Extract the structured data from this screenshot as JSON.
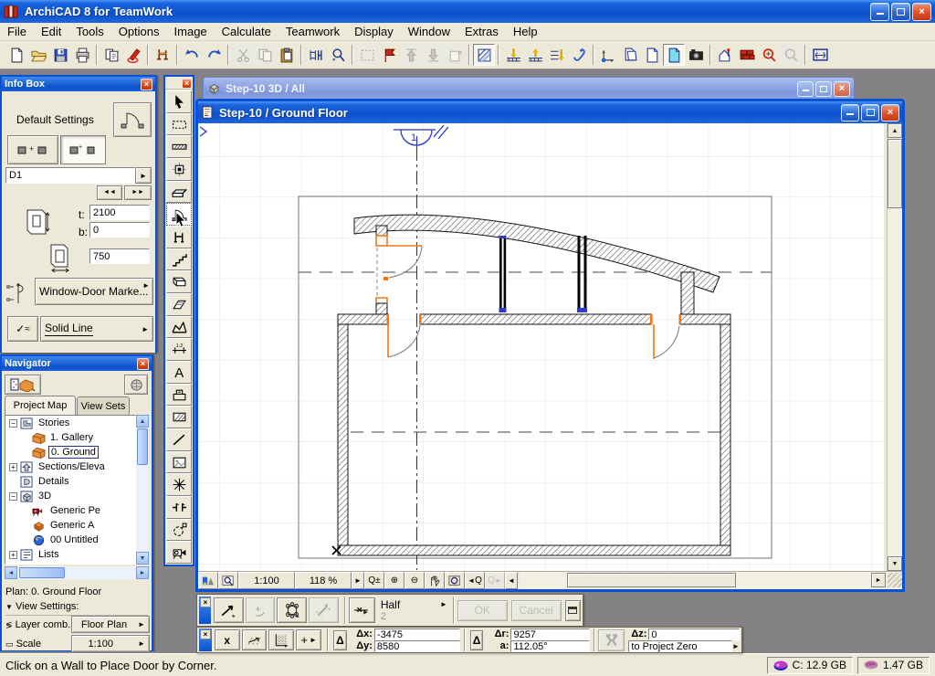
{
  "window": {
    "title": "ArchiCAD 8 for TeamWork"
  },
  "menu": {
    "items": [
      "File",
      "Edit",
      "Tools",
      "Options",
      "Image",
      "Calculate",
      "Teamwork",
      "Display",
      "Window",
      "Extras",
      "Help"
    ]
  },
  "toolbar": {
    "buttons": [
      {
        "name": "new-document"
      },
      {
        "name": "open"
      },
      {
        "name": "save"
      },
      {
        "name": "print"
      },
      {
        "sep": 1
      },
      {
        "name": "publisher"
      },
      {
        "name": "mark-up"
      },
      {
        "sep": 1
      },
      {
        "name": "teamwork"
      },
      {
        "sep": 1
      },
      {
        "name": "undo"
      },
      {
        "name": "redo"
      },
      {
        "sep": 1
      },
      {
        "name": "cut",
        "state": "disabled"
      },
      {
        "name": "copy",
        "state": "disabled"
      },
      {
        "name": "paste"
      },
      {
        "sep": 1
      },
      {
        "name": "dimensions"
      },
      {
        "name": "find-select"
      },
      {
        "sep": 1
      },
      {
        "name": "selections",
        "state": "disabled"
      },
      {
        "name": "review"
      },
      {
        "name": "pick-up-parameters",
        "state": "disabled"
      },
      {
        "name": "transfer-parameters",
        "state": "disabled"
      },
      {
        "name": "element-settings",
        "state": "disabled"
      },
      {
        "sep": 1
      },
      {
        "name": "wall-accessories",
        "state": "pressed"
      },
      {
        "sep": 1
      },
      {
        "name": "go-down-a-story"
      },
      {
        "name": "go-up-a-story"
      },
      {
        "name": "go-to-story"
      },
      {
        "name": "quick-layers"
      },
      {
        "sep": 1
      },
      {
        "name": "set-origin"
      },
      {
        "name": "copy-picture"
      },
      {
        "name": "new-drawing"
      },
      {
        "name": "show-3d",
        "state": "pressed"
      },
      {
        "name": "photo-render"
      },
      {
        "sep": 1
      },
      {
        "name": "place-object"
      },
      {
        "name": "building-materials"
      },
      {
        "name": "find-zoom"
      },
      {
        "name": "zoom-back",
        "state": "disabled"
      },
      {
        "sep": 1
      },
      {
        "name": "fit-in-window"
      }
    ]
  },
  "infobox": {
    "title": "Info Box",
    "default_settings_label": "Default Settings",
    "item_id": "D1",
    "t_label": "t:",
    "t_value": "2100",
    "b_label": "b:",
    "b_value": "0",
    "width_value": "750",
    "marker_button_label": "Window-Door Marke...",
    "line_type_label": "Solid Line",
    "prev_label": "◄◄",
    "next_label": "►►"
  },
  "navigator": {
    "title": "Navigator",
    "tabs": [
      "Project Map",
      "View Sets"
    ],
    "tree": [
      {
        "label": "Stories",
        "icon": "stories",
        "expander": "minus",
        "indent": 1
      },
      {
        "label": "1. Gallery",
        "icon": "story",
        "indent": 2
      },
      {
        "label": "0. Ground",
        "icon": "story",
        "indent": 2,
        "selected": true
      },
      {
        "label": "Sections/Eleva",
        "icon": "section",
        "expander": "plus",
        "indent": 1
      },
      {
        "label": "Details",
        "icon": "detail",
        "indent": 1
      },
      {
        "label": "3D",
        "icon": "threed",
        "expander": "minus",
        "indent": 1
      },
      {
        "label": "Generic Pe",
        "icon": "camera",
        "indent": 2
      },
      {
        "label": "Generic A",
        "icon": "axon",
        "indent": 2
      },
      {
        "label": "00 Untitled",
        "icon": "threedwin",
        "indent": 2
      },
      {
        "label": "Lists",
        "icon": "lists",
        "expander": "plus",
        "indent": 1
      }
    ],
    "plan_label": "Plan: 0. Ground Floor",
    "view_settings_label": "View Settings:",
    "layer_comb_label": "Layer comb.",
    "layer_comb_value": "Floor Plan",
    "scale_label": "Scale",
    "scale_value": "1:100"
  },
  "tool_palette": {
    "active": "door",
    "tools": [
      "arrow",
      "marquee",
      "wall",
      "column",
      "beam",
      "door",
      "object",
      "stair",
      "slab",
      "roof",
      "mesh",
      "dimension",
      "text",
      "zone",
      "fill",
      "line",
      "figure",
      "hotspot",
      "section",
      "detail",
      "camera"
    ]
  },
  "doc_windows": {
    "background": {
      "title": "Step-10 3D / All"
    },
    "foreground": {
      "title": "Step-10 / Ground Floor"
    }
  },
  "drawing": {
    "section_marker_label": "1"
  },
  "zoombar": {
    "scale": "1:100",
    "zoom": "118 %",
    "zoom_pm": "Q±",
    "zoom_in": "⊕",
    "zoom_out": "⊖"
  },
  "controlbox": {
    "snap_value": "Half",
    "snap_alt": "2",
    "ok_label": "OK",
    "cancel_label": "Cancel"
  },
  "coordbox": {
    "dx_label": "Δx:",
    "dx_value": "-3475",
    "dy_label": "Δy:",
    "dy_value": "8580",
    "dr_label": "Δr:",
    "dr_value": "9257",
    "a_label": "a:",
    "a_value": "112.05°",
    "dz_label": "Δz:",
    "dz_value": "0",
    "z_reference": "to Project Zero"
  },
  "statusbar": {
    "message": "Click on a Wall to Place Door by Corner.",
    "disk": "C: 12.9 GB",
    "memory": "1.47 GB"
  },
  "colors": {
    "accent": "#0A50D4",
    "close": "#D84818",
    "selection_orange": "#F07818",
    "workspace": "#848284"
  }
}
